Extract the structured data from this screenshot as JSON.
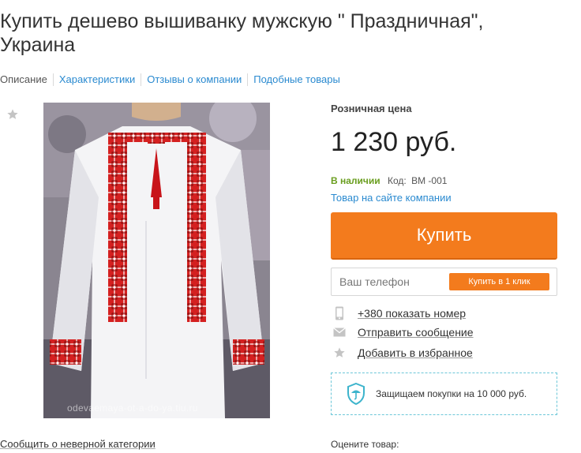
{
  "page": {
    "title": "Купить дешево вышиванку мужскую \" Праздничная\", Украина"
  },
  "tabs": [
    {
      "label": "Описание"
    },
    {
      "label": "Характеристики"
    },
    {
      "label": "Отзывы о компании"
    },
    {
      "label": "Подобные товары"
    }
  ],
  "photo": {
    "watermark": "odevaemaya-ot-a-do-ya.tiu.ru"
  },
  "report_link": "Сообщить о неверной категории",
  "product": {
    "price_label": "Розничная цена",
    "price": "1 230 руб.",
    "availability": "В наличии",
    "code_label": "Код:",
    "code_value": "BM -001",
    "company_link": "Товар на сайте компании",
    "buy_label": "Купить",
    "phone_placeholder": "Ваш телефон",
    "one_click_label": "Купить в 1 клик"
  },
  "actions": [
    {
      "icon": "phone-icon",
      "label": "+380 показать номер"
    },
    {
      "icon": "envelope-icon",
      "label": "Отправить сообщение"
    },
    {
      "icon": "star-icon",
      "label": "Добавить в избранное"
    }
  ],
  "protection": {
    "icon": "umbrella-shield-icon",
    "text": "Защищаем покупки на 10 000 руб."
  },
  "rating_label": "Оцените товар:",
  "colors": {
    "accent_orange": "#f37b1d",
    "link_blue": "#2a8ad0",
    "in_stock_green": "#6a9e1f",
    "protect_border": "#6cc7d8",
    "icon_gray": "#c4c4c4"
  }
}
